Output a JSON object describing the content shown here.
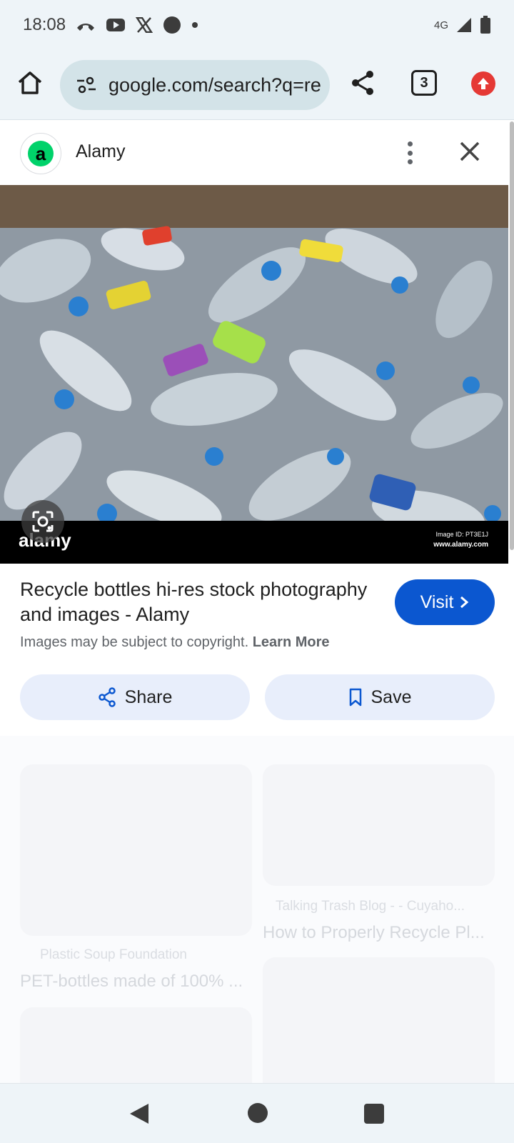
{
  "status_bar": {
    "time": "18:08",
    "network": "4G"
  },
  "browser": {
    "url": "google.com/search?q=re",
    "tab_count": "3"
  },
  "panel": {
    "source_name": "Alamy",
    "favicon_letter": "a",
    "image_watermark": "alamy",
    "image_id": "Image ID: PT3E1J",
    "image_site": "www.alamy.com",
    "title": "Recycle bottles hi-res stock photography and images - Alamy",
    "copyright_text": "Images may be subject to copyright.",
    "learn_more": "Learn More",
    "visit_label": "Visit",
    "share_label": "Share",
    "save_label": "Save"
  },
  "related": [
    {
      "source": "Plastic Soup Foundation",
      "title": "PET-bottles made of 100% ..."
    },
    {
      "source": "Talking Trash Blog - - Cuyaho...",
      "title": "How to Properly Recycle Pl..."
    }
  ],
  "colors": {
    "accent": "#0b57d0",
    "chrome_bg": "#eef4f8",
    "action_bg": "#e8eefb",
    "update_red": "#e53935",
    "favicon_green": "#00d26a"
  },
  "icons": [
    "home-icon",
    "tune-icon",
    "share-icon",
    "tab-switcher-icon",
    "update-icon",
    "more-vert-icon",
    "close-icon",
    "lens-icon",
    "chevron-right-icon",
    "bookmark-icon",
    "back-icon"
  ]
}
